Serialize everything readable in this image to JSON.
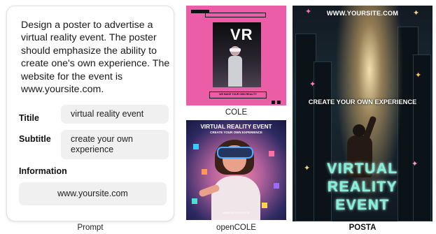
{
  "prompt": {
    "text": "Design a poster to advertise a virtual reality event. The poster should emphasize the ability to create one's own experience. The website for the event is www.yoursite.com.",
    "fields": [
      {
        "label": "Titile",
        "value": "virtual reality event"
      },
      {
        "label": "Subtitle",
        "value": "create your own experience"
      }
    ],
    "information_label": "Information",
    "information_value": "www.yoursite.com"
  },
  "captions": {
    "prompt": "Prompt",
    "cole": "COLE",
    "opencole": "openCOLE",
    "posta": "POSTA"
  },
  "posters": {
    "cole": {
      "heading": "VR",
      "tagline": "WE MAKE YOUR OWN REALITY"
    },
    "opencole": {
      "title": "VIRTUAL REALITY EVENT",
      "subtitle": "CREATE YOUR OWN EXPERIENCE",
      "url": "WWW.YOURSITE.COM"
    },
    "posta": {
      "url": "WWW.YOURSITE.COM",
      "tagline": "CREATE YOUR OWN EXPERIENCE",
      "title_lines": [
        "VIRTUAL",
        "REALITY",
        "EVENT"
      ]
    }
  },
  "colors": {
    "cole_background": "#ec5da7",
    "posta_title": "#7ff2d8"
  }
}
